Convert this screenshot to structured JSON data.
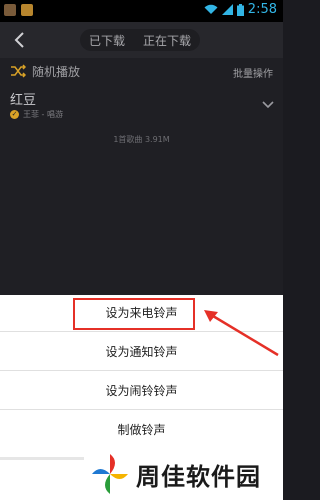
{
  "status_bar": {
    "time": "2:58"
  },
  "header": {
    "tabs": [
      {
        "label": "已下载"
      },
      {
        "label": "正在下载"
      }
    ]
  },
  "list": {
    "shuffle_label": "随机播放",
    "batch_label": "批量操作",
    "song": {
      "title": "红豆",
      "meta": "王菲 - 唱游"
    },
    "count_text": "1首歌曲 3.91M"
  },
  "sheet": {
    "items": [
      {
        "label": "设为来电铃声"
      },
      {
        "label": "设为通知铃声"
      },
      {
        "label": "设为闹铃铃声"
      },
      {
        "label": "制做铃声"
      }
    ]
  },
  "watermark": {
    "text": "周佳软件园"
  },
  "colors": {
    "accent": "#32b5e5",
    "highlight": "#e53027"
  }
}
